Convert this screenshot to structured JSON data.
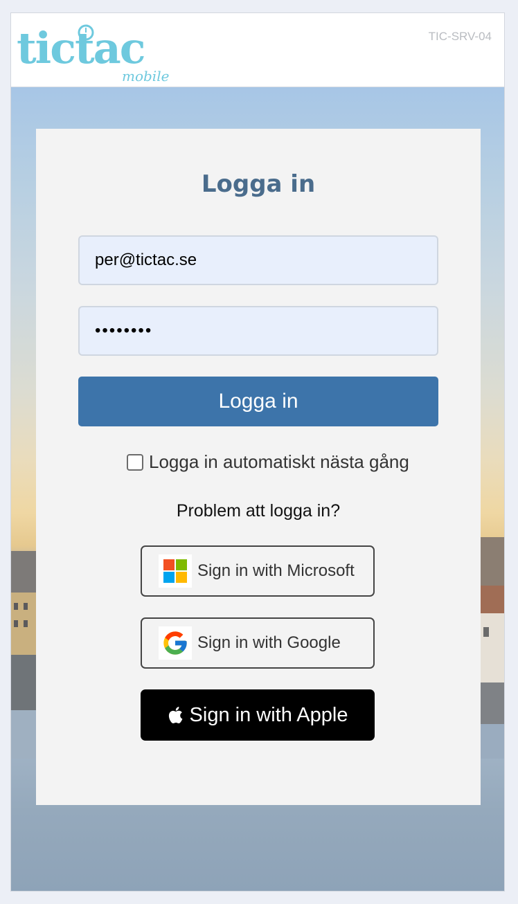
{
  "header": {
    "logo_text": "tictac",
    "logo_subtext": "mobile",
    "server_id": "TIC-SRV-04"
  },
  "login": {
    "title": "Logga in",
    "email_value": "per@tictac.se",
    "password_value": "••••••••",
    "submit_label": "Logga in",
    "auto_login_label": "Logga in automatiskt nästa gång",
    "auto_login_checked": false,
    "problem_link": "Problem att logga in?"
  },
  "sso": {
    "microsoft_label": "Sign in with Microsoft",
    "google_label": "Sign in with Google",
    "apple_label": "Sign in with Apple"
  },
  "colors": {
    "brand_logo": "#6ec9de",
    "primary_button": "#3d74aa",
    "title": "#4a6c8c"
  }
}
